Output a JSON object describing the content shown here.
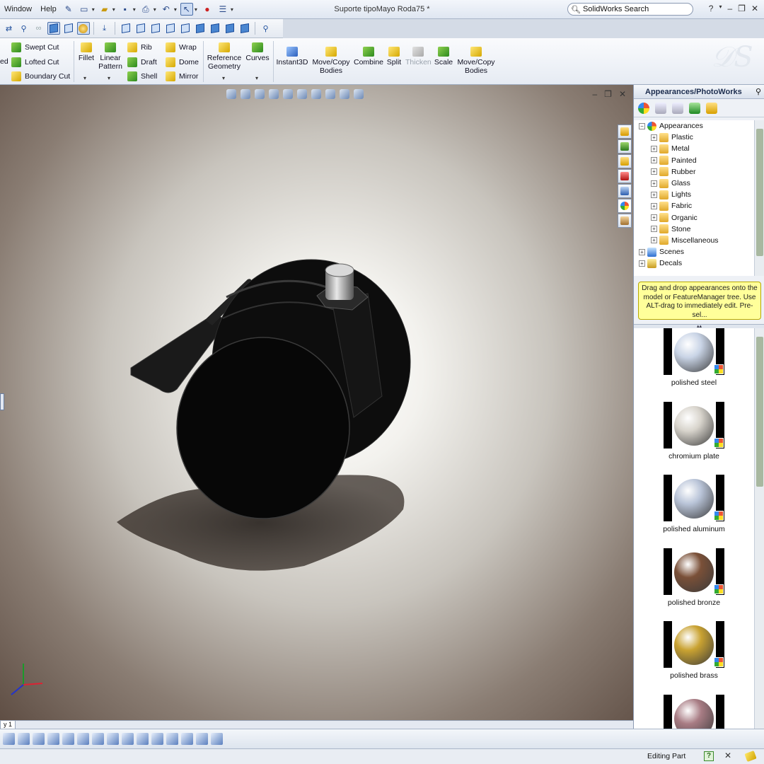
{
  "window": {
    "title": "Suporte tipoMayo Roda75 *",
    "menu": [
      "Window",
      "Help"
    ],
    "search_placeholder": "SolidWorks Search"
  },
  "ribbon": {
    "left_tools": [
      "Swept Cut",
      "Lofted Cut",
      "Boundary Cut"
    ],
    "partial_label": "ed",
    "fillet": "Fillet",
    "linear_pattern_1": "Linear",
    "linear_pattern_2": "Pattern",
    "mid_tools": [
      "Rib",
      "Draft",
      "Shell"
    ],
    "mid2_tools": [
      "Wrap",
      "Dome",
      "Mirror"
    ],
    "ref_geom_1": "Reference",
    "ref_geom_2": "Geometry",
    "curves": "Curves",
    "instant3d": "Instant3D",
    "move_copy_1": "Move/Copy",
    "move_copy_2": "Bodies",
    "combine": "Combine",
    "split": "Split",
    "thicken": "Thicken",
    "scale": "Scale",
    "move_copy2_1": "Move/Copy",
    "move_copy2_2": "Bodies"
  },
  "pane": {
    "title": "Appearances/PhotoWorks",
    "tree_root": "Appearances",
    "tree_children": [
      "Plastic",
      "Metal",
      "Painted",
      "Rubber",
      "Glass",
      "Lights",
      "Fabric",
      "Organic",
      "Stone",
      "Miscellaneous"
    ],
    "tree_scenes": "Scenes",
    "tree_decals": "Decals",
    "hint": "Drag and drop appearances onto the model or FeatureManager tree.  Use ALT-drag to immediately edit.  Pre-sel...",
    "swatches": [
      {
        "name": "polished steel",
        "color": "#c9d4e6"
      },
      {
        "name": "chromium plate",
        "color": "#d8d4cc"
      },
      {
        "name": "polished aluminum",
        "color": "#b9c4d8"
      },
      {
        "name": "polished bronze",
        "color": "#7a5038"
      },
      {
        "name": "polished brass",
        "color": "#c9a231"
      },
      {
        "name": "",
        "color": "#a87c84"
      }
    ]
  },
  "viewport": {
    "tab_label": "y 1"
  },
  "status": {
    "mode": "Editing Part",
    "help": "?"
  }
}
